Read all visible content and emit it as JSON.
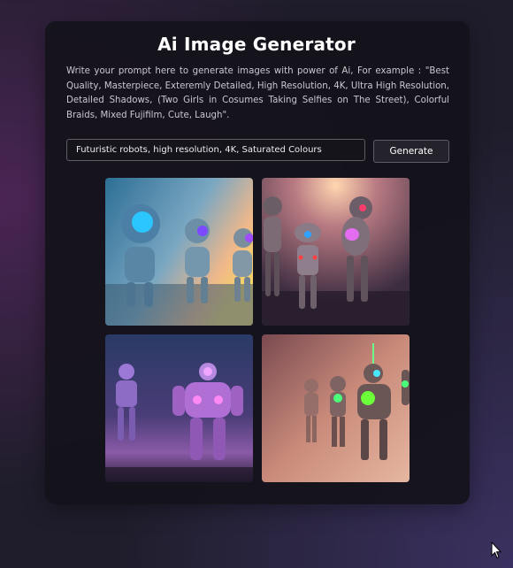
{
  "app": {
    "title": "Ai Image Generator",
    "description": "Write your prompt here to generate images with power of Ai, For example : \"Best Quality, Masterpiece, Exteremly Detailed, High Resolution, 4K, Ultra High Resolution, Detailed Shadows, (Two Girls in Cosumes Taking Selfies on The Street), Colorful Braids, Mixed Fujifilm, Cute, Laugh\"."
  },
  "prompt_input": {
    "value": "Futuristic robots, high resolution, 4K, Saturated Colours"
  },
  "generate_button": {
    "label": "Generate"
  },
  "colors": {
    "background": "#1f1d2b",
    "card": "#141218",
    "border": "#5e5c64",
    "text": "#ffffff"
  },
  "images": [
    {
      "icon": "robot-image-1"
    },
    {
      "icon": "robot-image-2"
    },
    {
      "icon": "robot-image-3"
    },
    {
      "icon": "robot-image-4"
    }
  ]
}
